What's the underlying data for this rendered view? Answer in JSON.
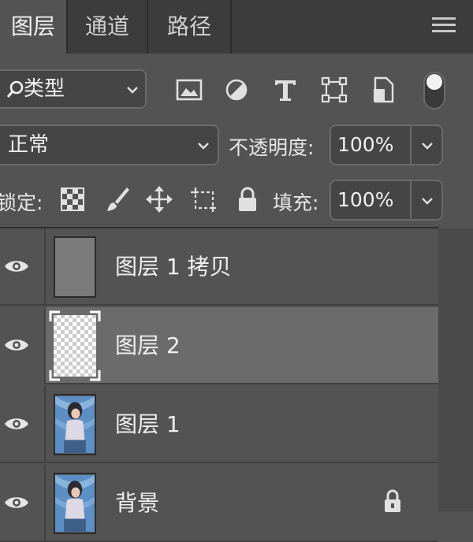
{
  "tabs": [
    {
      "label": "图层",
      "active": true
    },
    {
      "label": "通道",
      "active": false
    },
    {
      "label": "路径",
      "active": false
    }
  ],
  "icons": {
    "panel_menu": "hamburger-menu-icon",
    "filter_search": "magnifier-icon",
    "filters": [
      "image-icon",
      "adjustment-icon",
      "type-icon",
      "shape-icon",
      "smart-object-icon"
    ],
    "filter_toggle": "toggle-icon",
    "locks": [
      "checkerboard-icon",
      "brush-icon",
      "move-icon",
      "artboard-icon",
      "lock-icon"
    ],
    "visibility": "eye-icon"
  },
  "filter": {
    "label": "类型",
    "search_glyph": "⚲"
  },
  "blend_mode": {
    "value": "正常"
  },
  "opacity": {
    "label": "不透明度:",
    "value": "100%"
  },
  "lock": {
    "label": "锁定:"
  },
  "fill": {
    "label": "填充:",
    "value": "100%"
  },
  "layers": [
    {
      "name": "图层 1 拷贝",
      "thumb": "gray",
      "selected": false,
      "locked": false
    },
    {
      "name": "图层 2",
      "thumb": "transparent",
      "selected": true,
      "locked": false
    },
    {
      "name": "图层 1",
      "thumb": "photo",
      "selected": false,
      "locked": false
    },
    {
      "name": "背景",
      "thumb": "photo",
      "selected": false,
      "locked": true
    }
  ],
  "colors": {
    "panel_bg": "#535353",
    "tabbar_bg": "#3c3c3c",
    "selected_row": "#6b6b6b"
  }
}
